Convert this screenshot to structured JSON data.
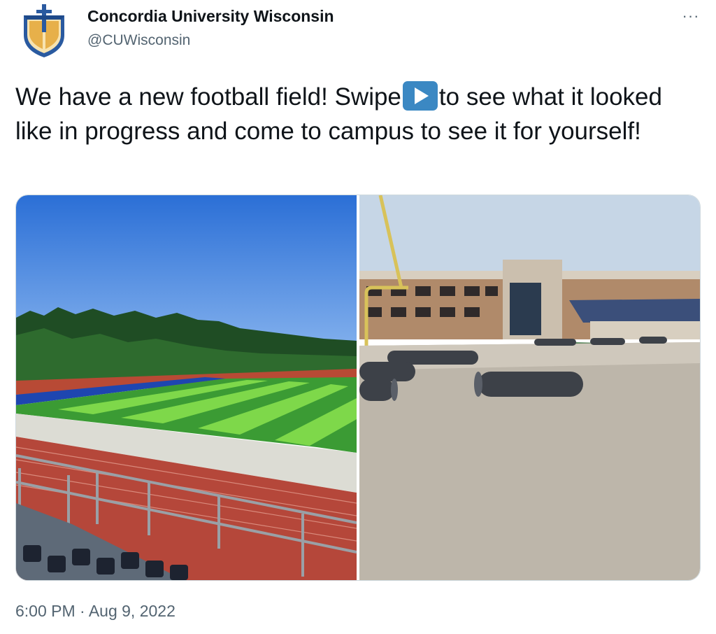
{
  "author": {
    "name": "Concordia University Wisconsin",
    "handle": "@CUWisconsin",
    "avatar_icon": "concordia-shield-logo-icon"
  },
  "menu": {
    "more_label": "···"
  },
  "tweet": {
    "text_before_emoji": "We have a new football field! Swipe",
    "emoji_icon": "play-button-emoji-icon",
    "text_after_emoji": "to see what it looked like in progress and come to campus to see it for yourself!"
  },
  "media": {
    "photo_count": 2,
    "photos": [
      {
        "icon": "new-football-field-photo"
      },
      {
        "icon": "field-in-progress-photo"
      }
    ]
  },
  "timestamp": "6:00 PM · Aug 9, 2022",
  "colors": {
    "text": "#0f1419",
    "secondary_text": "#536471",
    "border": "#cfd9de",
    "emoji_blue": "#3b88c3",
    "logo_blue": "#2a5aa0",
    "logo_gold": "#e7b04a"
  }
}
